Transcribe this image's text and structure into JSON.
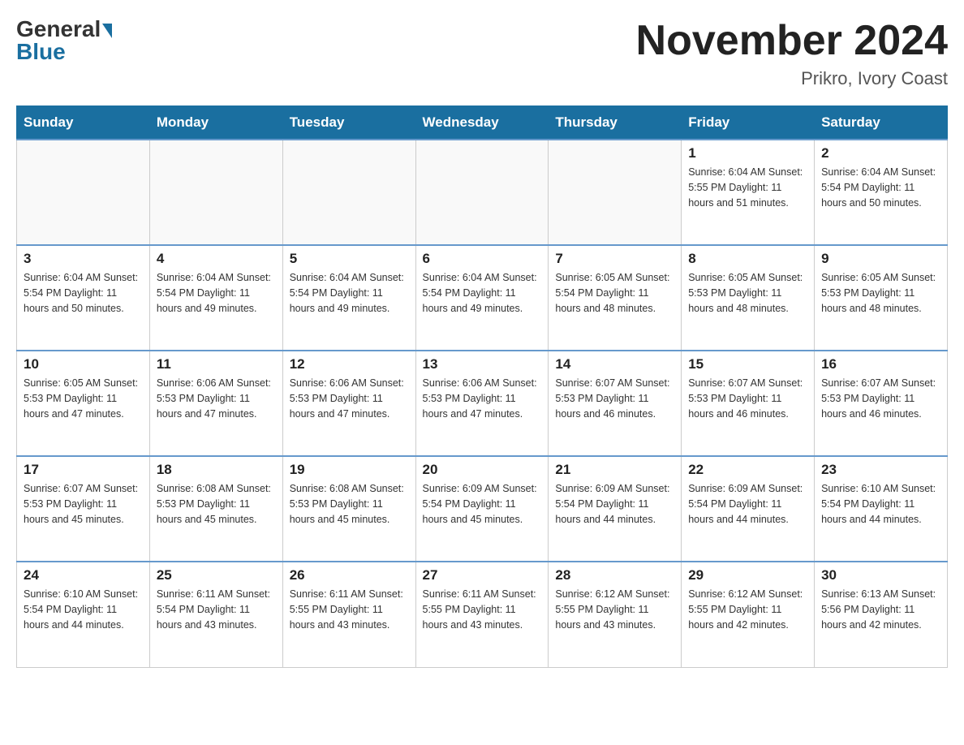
{
  "logo": {
    "general": "General",
    "blue": "Blue"
  },
  "title": "November 2024",
  "location": "Prikro, Ivory Coast",
  "days_of_week": [
    "Sunday",
    "Monday",
    "Tuesday",
    "Wednesday",
    "Thursday",
    "Friday",
    "Saturday"
  ],
  "weeks": [
    [
      {
        "day": "",
        "info": ""
      },
      {
        "day": "",
        "info": ""
      },
      {
        "day": "",
        "info": ""
      },
      {
        "day": "",
        "info": ""
      },
      {
        "day": "",
        "info": ""
      },
      {
        "day": "1",
        "info": "Sunrise: 6:04 AM\nSunset: 5:55 PM\nDaylight: 11 hours and 51 minutes."
      },
      {
        "day": "2",
        "info": "Sunrise: 6:04 AM\nSunset: 5:54 PM\nDaylight: 11 hours and 50 minutes."
      }
    ],
    [
      {
        "day": "3",
        "info": "Sunrise: 6:04 AM\nSunset: 5:54 PM\nDaylight: 11 hours and 50 minutes."
      },
      {
        "day": "4",
        "info": "Sunrise: 6:04 AM\nSunset: 5:54 PM\nDaylight: 11 hours and 49 minutes."
      },
      {
        "day": "5",
        "info": "Sunrise: 6:04 AM\nSunset: 5:54 PM\nDaylight: 11 hours and 49 minutes."
      },
      {
        "day": "6",
        "info": "Sunrise: 6:04 AM\nSunset: 5:54 PM\nDaylight: 11 hours and 49 minutes."
      },
      {
        "day": "7",
        "info": "Sunrise: 6:05 AM\nSunset: 5:54 PM\nDaylight: 11 hours and 48 minutes."
      },
      {
        "day": "8",
        "info": "Sunrise: 6:05 AM\nSunset: 5:53 PM\nDaylight: 11 hours and 48 minutes."
      },
      {
        "day": "9",
        "info": "Sunrise: 6:05 AM\nSunset: 5:53 PM\nDaylight: 11 hours and 48 minutes."
      }
    ],
    [
      {
        "day": "10",
        "info": "Sunrise: 6:05 AM\nSunset: 5:53 PM\nDaylight: 11 hours and 47 minutes."
      },
      {
        "day": "11",
        "info": "Sunrise: 6:06 AM\nSunset: 5:53 PM\nDaylight: 11 hours and 47 minutes."
      },
      {
        "day": "12",
        "info": "Sunrise: 6:06 AM\nSunset: 5:53 PM\nDaylight: 11 hours and 47 minutes."
      },
      {
        "day": "13",
        "info": "Sunrise: 6:06 AM\nSunset: 5:53 PM\nDaylight: 11 hours and 47 minutes."
      },
      {
        "day": "14",
        "info": "Sunrise: 6:07 AM\nSunset: 5:53 PM\nDaylight: 11 hours and 46 minutes."
      },
      {
        "day": "15",
        "info": "Sunrise: 6:07 AM\nSunset: 5:53 PM\nDaylight: 11 hours and 46 minutes."
      },
      {
        "day": "16",
        "info": "Sunrise: 6:07 AM\nSunset: 5:53 PM\nDaylight: 11 hours and 46 minutes."
      }
    ],
    [
      {
        "day": "17",
        "info": "Sunrise: 6:07 AM\nSunset: 5:53 PM\nDaylight: 11 hours and 45 minutes."
      },
      {
        "day": "18",
        "info": "Sunrise: 6:08 AM\nSunset: 5:53 PM\nDaylight: 11 hours and 45 minutes."
      },
      {
        "day": "19",
        "info": "Sunrise: 6:08 AM\nSunset: 5:53 PM\nDaylight: 11 hours and 45 minutes."
      },
      {
        "day": "20",
        "info": "Sunrise: 6:09 AM\nSunset: 5:54 PM\nDaylight: 11 hours and 45 minutes."
      },
      {
        "day": "21",
        "info": "Sunrise: 6:09 AM\nSunset: 5:54 PM\nDaylight: 11 hours and 44 minutes."
      },
      {
        "day": "22",
        "info": "Sunrise: 6:09 AM\nSunset: 5:54 PM\nDaylight: 11 hours and 44 minutes."
      },
      {
        "day": "23",
        "info": "Sunrise: 6:10 AM\nSunset: 5:54 PM\nDaylight: 11 hours and 44 minutes."
      }
    ],
    [
      {
        "day": "24",
        "info": "Sunrise: 6:10 AM\nSunset: 5:54 PM\nDaylight: 11 hours and 44 minutes."
      },
      {
        "day": "25",
        "info": "Sunrise: 6:11 AM\nSunset: 5:54 PM\nDaylight: 11 hours and 43 minutes."
      },
      {
        "day": "26",
        "info": "Sunrise: 6:11 AM\nSunset: 5:55 PM\nDaylight: 11 hours and 43 minutes."
      },
      {
        "day": "27",
        "info": "Sunrise: 6:11 AM\nSunset: 5:55 PM\nDaylight: 11 hours and 43 minutes."
      },
      {
        "day": "28",
        "info": "Sunrise: 6:12 AM\nSunset: 5:55 PM\nDaylight: 11 hours and 43 minutes."
      },
      {
        "day": "29",
        "info": "Sunrise: 6:12 AM\nSunset: 5:55 PM\nDaylight: 11 hours and 42 minutes."
      },
      {
        "day": "30",
        "info": "Sunrise: 6:13 AM\nSunset: 5:56 PM\nDaylight: 11 hours and 42 minutes."
      }
    ]
  ]
}
